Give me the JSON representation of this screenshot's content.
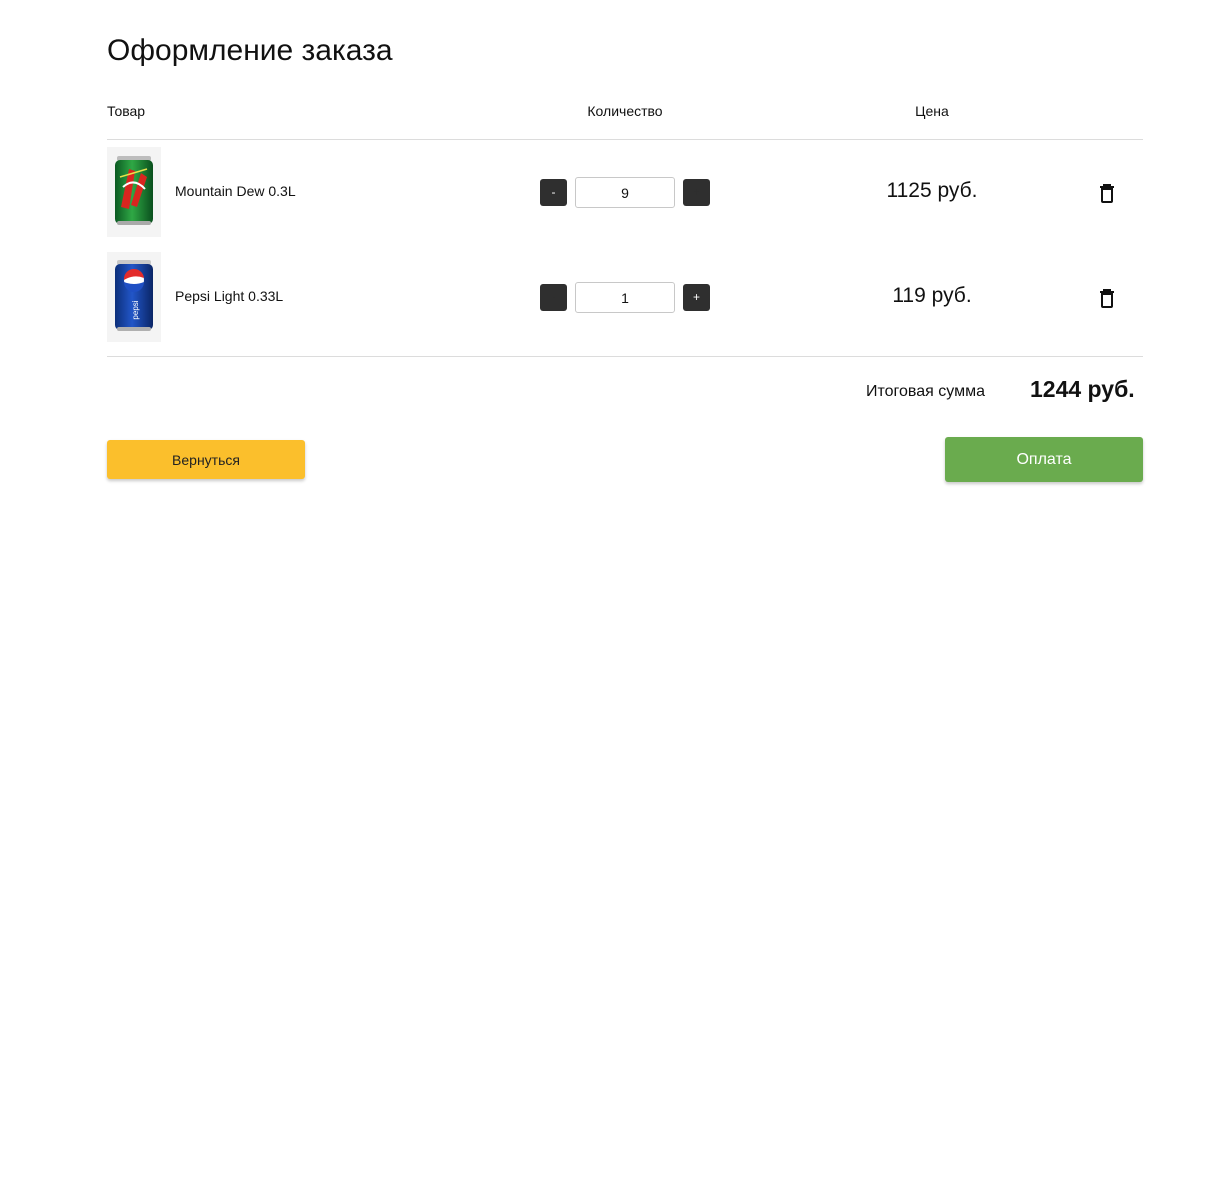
{
  "page": {
    "title": "Оформление заказа"
  },
  "table": {
    "headers": {
      "product": "Товар",
      "quantity": "Количество",
      "price": "Цена"
    },
    "rows": [
      {
        "name": "Mountain Dew 0.3L",
        "quantity": "9",
        "price": "1125 руб.",
        "minus_label": "-",
        "plus_label": "+",
        "image_icon": "soda-can-green-icon"
      },
      {
        "name": "Pepsi Light 0.33L",
        "quantity": "1",
        "price": "119 руб.",
        "minus_label": "-",
        "plus_label": "+",
        "image_icon": "soda-can-blue-icon"
      }
    ]
  },
  "summary": {
    "label": "Итоговая сумма",
    "total": "1244 руб."
  },
  "actions": {
    "back_label": "Вернуться",
    "pay_label": "Оплата"
  },
  "colors": {
    "back_button": "#fbbf2c",
    "pay_button": "#6aab4e",
    "stepper_button": "#2f2f2f"
  }
}
